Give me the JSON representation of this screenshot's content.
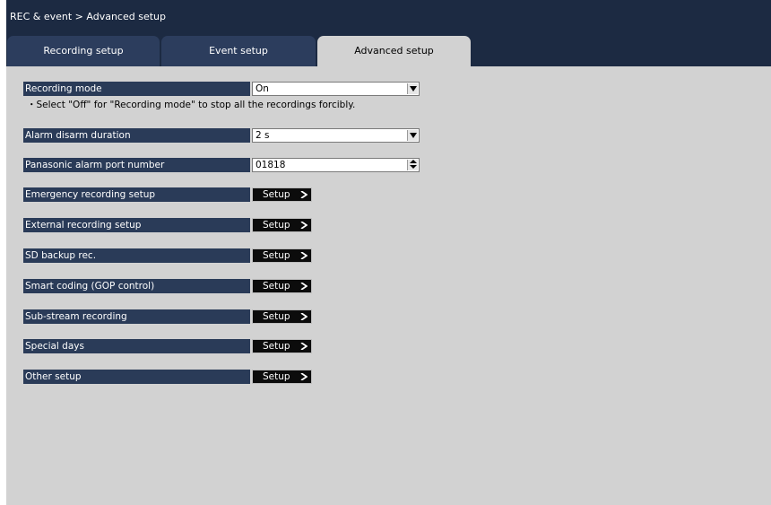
{
  "header": {
    "breadcrumb": "REC & event > Advanced setup"
  },
  "tabs": [
    {
      "label": "Recording setup",
      "active": false
    },
    {
      "label": "Event setup",
      "active": false
    },
    {
      "label": "Advanced setup",
      "active": true
    }
  ],
  "settings": {
    "recording_mode": {
      "label": "Recording mode",
      "value": "On",
      "note": "・Select \"Off\" for \"Recording mode\" to stop all the recordings forcibly."
    },
    "alarm_disarm": {
      "label": "Alarm disarm duration",
      "value": "2 s"
    },
    "alarm_port": {
      "label": "Panasonic alarm port number",
      "value": "01818"
    }
  },
  "setup_rows": [
    {
      "label": "Emergency recording setup",
      "button": "Setup"
    },
    {
      "label": "External recording setup",
      "button": "Setup"
    },
    {
      "label": "SD backup rec.",
      "button": "Setup"
    },
    {
      "label": "Smart coding (GOP control)",
      "button": "Setup"
    },
    {
      "label": "Sub-stream recording",
      "button": "Setup"
    },
    {
      "label": "Special days",
      "button": "Setup"
    },
    {
      "label": "Other setup",
      "button": "Setup"
    }
  ],
  "icons": {
    "dropdown": "chevron-down-icon",
    "spinner": "spinner-arrows-icon",
    "setup_arrow": "chevron-right-icon"
  },
  "colors": {
    "header_bg": "#1c2a42",
    "label_bg": "#2a3b58",
    "panel_bg": "#d2d2d2",
    "button_bg": "#0c0c0c"
  }
}
